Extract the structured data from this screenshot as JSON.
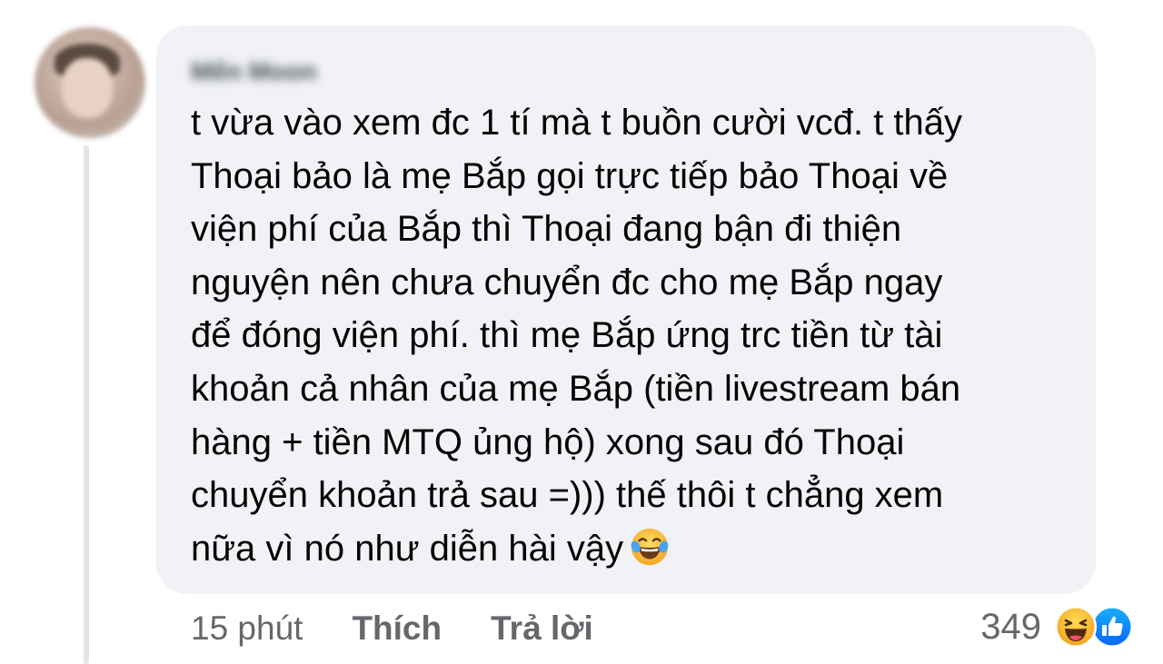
{
  "comment": {
    "author_name": "Mến Moon",
    "text": "t vừa vào xem đc 1 tí mà t buồn cười vcđ. t thấy\nThoại bảo là mẹ Bắp gọi trực tiếp bảo Thoại về\nviện phí của Bắp thì Thoại đang bận đi thiện\nnguyện nên chưa chuyển đc cho mẹ Bắp ngay\nđể đóng viện phí. thì mẹ Bắp ứng trc tiền từ tài\nkhoản cả nhân của mẹ Bắp (tiền livestream bán\nhàng + tiền MTQ ủng hộ) xong sau đó Thoại\nchuyển khoản trả sau =))) thế thôi t chẳng xem\nnữa vì nó như diễn hài vậy",
    "inline_emoji": "laughing-tears-emoji"
  },
  "actions": {
    "time": "15 phút",
    "like_label": "Thích",
    "reply_label": "Trả lời"
  },
  "reactions": {
    "count": "349",
    "icons": [
      "haha-reaction-icon",
      "like-reaction-icon"
    ]
  },
  "colors": {
    "bubble_bg": "#f0f2f5",
    "text": "#050505",
    "secondary_text": "#65676b",
    "like_blue": "#1877f2",
    "haha_yellow": "#f7b125"
  }
}
